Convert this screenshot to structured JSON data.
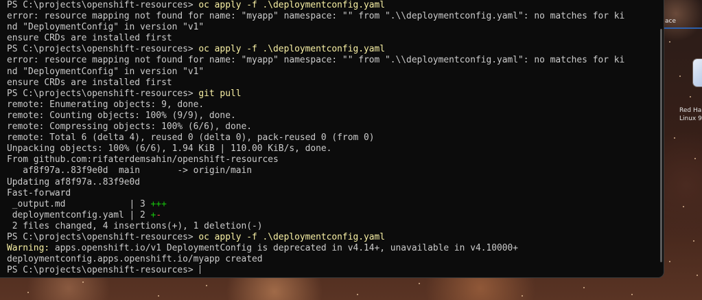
{
  "desktop": {
    "corner_text": "ace",
    "icon_label_line1": "Red Ha",
    "icon_label_line2": "Linux 9"
  },
  "terminal": {
    "lines": [
      {
        "prompt": "PS C:\\projects\\openshift-resources> ",
        "cmd": "oc apply -f .\\deploymentconfig.yaml"
      },
      {
        "text": "error: resource mapping not found for name: \"myapp\" namespace: \"\" from \".\\\\deploymentconfig.yaml\": no matches for ki"
      },
      {
        "text": "nd \"DeploymentConfig\" in version \"v1\""
      },
      {
        "text": "ensure CRDs are installed first"
      },
      {
        "prompt": "PS C:\\projects\\openshift-resources> ",
        "cmd": "oc apply -f .\\deploymentconfig.yaml"
      },
      {
        "text": "error: resource mapping not found for name: \"myapp\" namespace: \"\" from \".\\\\deploymentconfig.yaml\": no matches for ki"
      },
      {
        "text": "nd \"DeploymentConfig\" in version \"v1\""
      },
      {
        "text": "ensure CRDs are installed first"
      },
      {
        "prompt": "PS C:\\projects\\openshift-resources> ",
        "cmd": "git pull"
      },
      {
        "text": "remote: Enumerating objects: 9, done."
      },
      {
        "text": "remote: Counting objects: 100% (9/9), done."
      },
      {
        "text": "remote: Compressing objects: 100% (6/6), done."
      },
      {
        "text": "remote: Total 6 (delta 4), reused 0 (delta 0), pack-reused 0 (from 0)"
      },
      {
        "text": "Unpacking objects: 100% (6/6), 1.94 KiB | 110.00 KiB/s, done."
      },
      {
        "text": "From github.com:rifaterdemsahin/openshift-resources"
      },
      {
        "text": "   af8f97a..83f9e0d  main       -> origin/main"
      },
      {
        "text": "Updating af8f97a..83f9e0d"
      },
      {
        "text": "Fast-forward"
      },
      {
        "diff_file": " _output.md            | 3 ",
        "diff_plus": "+++",
        "diff_minus": ""
      },
      {
        "diff_file": " deploymentconfig.yaml | 2 ",
        "diff_plus": "+",
        "diff_minus": "-"
      },
      {
        "text": " 2 files changed, 4 insertions(+), 1 deletion(-)"
      },
      {
        "prompt": "PS C:\\projects\\openshift-resources> ",
        "cmd": "oc apply -f .\\deploymentconfig.yaml"
      },
      {
        "warn_label": "Warning:",
        "warn_text": " apps.openshift.io/v1 DeploymentConfig is deprecated in v4.14+, unavailable in v4.10000+"
      },
      {
        "text": "deploymentconfig.apps.openshift.io/myapp created"
      },
      {
        "prompt": "PS C:\\projects\\openshift-resources> ",
        "cmd": "",
        "cursor": true
      }
    ]
  }
}
